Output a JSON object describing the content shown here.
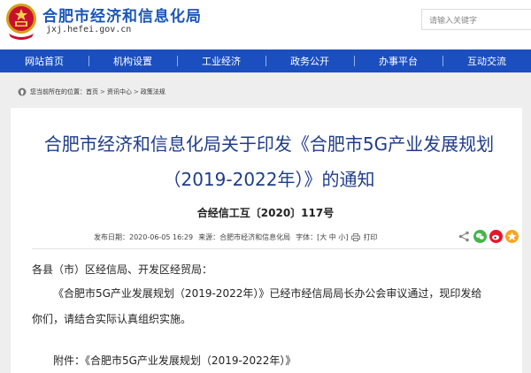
{
  "header": {
    "site_name": "合肥市经济和信息化局",
    "site_domain": "jxj.hefei.gov.cn",
    "search_placeholder": "请输入关键字",
    "emblem_icon": "national-emblem-icon"
  },
  "nav": {
    "items": [
      "网站首页",
      "机构设置",
      "工业经济",
      "政务公开",
      "办事平台",
      "互动交流"
    ],
    "color": "#1b4fbf"
  },
  "breadcrumb": {
    "prefix": "您当前所在的位置：",
    "items": [
      "首页",
      "资讯中心",
      "政策法规"
    ],
    "separator": ">"
  },
  "article": {
    "title": "合肥市经济和信息化局关于印发《合肥市5G产业发展规划（2019-2022年）》的通知",
    "doc_number": "合经信工互〔2020〕117号",
    "publish_time": "发布日期：2020-06-05 16:29",
    "source": "来源：合肥市经济和信息化局",
    "font_size_label": "字体：[",
    "font_size_large": "大",
    "font_size_medium": "中",
    "font_size_small": "小",
    "font_size_close": "]",
    "print_label": "打印",
    "salutation": "各县（市）区经信局、开发区经贸局：",
    "paragraph_line1": "《合肥市5G产业发展规划（2019-2022年）》已经市经信局局长办公会审议通过，现印发给",
    "paragraph_line2": "你们，请结合实际认真组织实施。",
    "attachment": "附件：《合肥市5G产业发展规划（2019-2022年）》"
  },
  "colors": {
    "title": "#1f3d8a",
    "site_name": "#1a56b8",
    "wechat": "#44b549",
    "weibo": "#e6162d",
    "qzone": "#f5a623"
  }
}
